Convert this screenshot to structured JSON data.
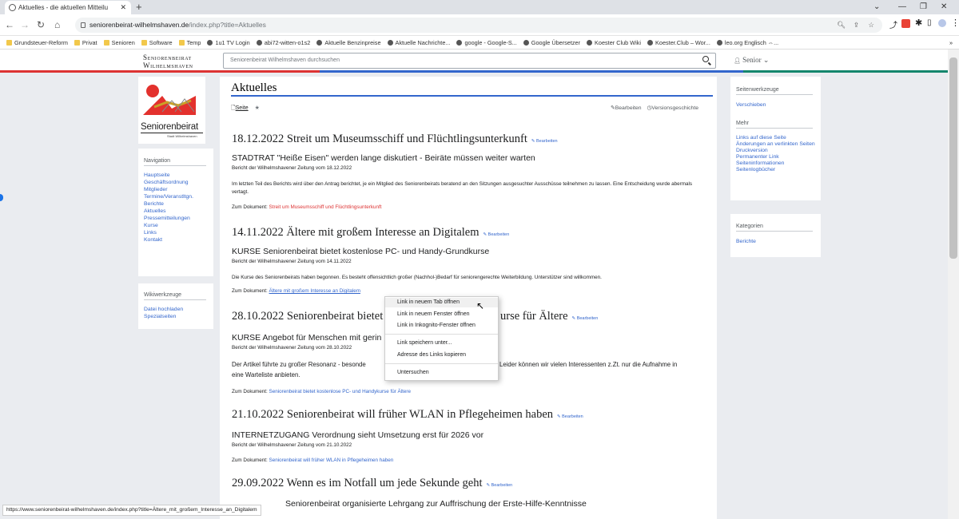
{
  "browser": {
    "tab_title": "Aktuelles - die aktuellen Mitteilu",
    "url_domain": "seniorenbeirat-wilhelmshaven.de",
    "url_path": "/index.php?title=Aktuelles",
    "bookmarks": [
      {
        "label": "Grundsteuer-Reform",
        "kind": "folder"
      },
      {
        "label": "Privat",
        "kind": "folder"
      },
      {
        "label": "Senioren",
        "kind": "folder"
      },
      {
        "label": "Software",
        "kind": "folder"
      },
      {
        "label": "Temp",
        "kind": "folder"
      },
      {
        "label": "1u1 TV Login",
        "kind": "site"
      },
      {
        "label": "abi72-witten-o1s2",
        "kind": "site"
      },
      {
        "label": "Aktuelle Benzinpreise",
        "kind": "site"
      },
      {
        "label": "Aktuelle Nachrichte...",
        "kind": "site"
      },
      {
        "label": "google - Google-S...",
        "kind": "site"
      },
      {
        "label": "Google Übersetzer",
        "kind": "site"
      },
      {
        "label": "Koester Club Wiki",
        "kind": "site"
      },
      {
        "label": "Koester.Club – Wor...",
        "kind": "site"
      },
      {
        "label": "leo.org Englisch ⇔...",
        "kind": "site"
      }
    ]
  },
  "site": {
    "logo_line1": "Seniorenbeirat",
    "logo_line2": "Wilhelmshaven",
    "search_placeholder": "Seniorenbeirat Wilhelmshaven durchsuchen",
    "user": "Senior ⌄",
    "colors": {
      "red": "#d33",
      "blue": "#36c",
      "green": "#14866d"
    }
  },
  "logo": {
    "name": "Seniorenbeirat",
    "city": "Stadt Wilhelmshaven"
  },
  "nav": {
    "heading": "Navigation",
    "items": [
      "Hauptseite",
      "Geschäftsordnung",
      "Mitglieder",
      "Termine/Veranstltgn.",
      "Berichte",
      "Aktuelles",
      "Pressemitteilungen",
      "Kurse",
      "Links",
      "Kontakt"
    ]
  },
  "wiki": {
    "heading": "Wikiwerkzeuge",
    "items": [
      "Datei hochladen",
      "Spezialseiten"
    ]
  },
  "content": {
    "title": "Aktuelles",
    "tab_page": "Seite",
    "edit": "Bearbeiten",
    "history": "Versionsgeschichte",
    "edit_small": "Bearbeiten",
    "zum": "Zum Dokument:",
    "articles": [
      {
        "heading": "18.12.2022 Streit um Museumsschiff und Flüchtlingsunterkunft",
        "sub": "STADTRAT \"Heiße Eisen\" werden lange diskutiert - Beiräte müssen weiter warten",
        "source": "Bericht der Wilhelmshavener Zeitung vom 18.12.2022",
        "text": "Im letzten Teil des Berichts wird über den Antrag berichtet, je ein Mitglied des Seniorenbeirats beratend an den Sitzungen ausgesuchter Ausschüsse teilnehmen zu lassen. Eine Entscheidung wurde abermals vertagt.",
        "link": "Streit um Museumsschiff und Flüchtlingsunterkunft"
      },
      {
        "heading": "14.11.2022 Ältere mit großem Interesse an Digitalem",
        "sub": "KURSE Seniorenbeirat bietet kostenlose PC- und Handy-Grundkurse",
        "source": "Bericht der Wilhelmshavener Zeitung vom 14.11.2022",
        "text": "Die Kurse des Seniorenbeirats haben begonnen. Es besteht offensichtlich großer (Nachhol-)Bedarf für seniorengerechte Weiterbildung. Unterstützer sind willkommen.",
        "link": "Ältere mit großem Interesse an Digitalem"
      },
      {
        "heading_left": "28.10.2022 Seniorenbeirat bietet ko",
        "heading_right": "urse für Ältere",
        "sub_left": "KURSE Angebot für Menschen mit gerin",
        "source": "Bericht der Wilhelmshavener Zeitung vom 28.10.2022",
        "text_left": "Der Artikel führte zu großer Resonanz - besonde",
        "text_right": "Leider können wir vielen Interessenten z.Zt. nur die Aufnahme in",
        "text_line2": "eine Warteliste anbieten.",
        "link": "Seniorenbeirat bietet kostenlose PC- und Handykurse für Ältere"
      },
      {
        "heading": "21.10.2022 Seniorenbeirat will früher WLAN in Pflegeheimen haben",
        "sub": "INTERNETZUGANG Verordnung sieht Umsetzung erst für 2026 vor",
        "source": "Bericht der Wilhelmshavener Zeitung vom 21.10.2022",
        "link": "Seniorenbeirat will früher WLAN in Pflegeheimen haben"
      },
      {
        "heading": "29.09.2022 Wenn es im Notfall um jede Sekunde geht",
        "sub_tail": "Seniorenbeirat organisierte Lehrgang zur Auffrischung der Erste-Hilfe-Kenntnisse"
      }
    ]
  },
  "right": {
    "heading1": "Seitenwerkzeuge",
    "item1": "Verschieben",
    "heading2": "Mehr",
    "items2": [
      "Links auf diese Seite",
      "Änderungen an verlinkten Seiten",
      "Druckversion",
      "Permanenter Link",
      "Seiteninformationen",
      "Seitenlogbücher"
    ],
    "heading3": "Kategorien",
    "item3": "Berichte"
  },
  "context_menu": [
    "Link in neuem Tab öffnen",
    "Link in neuem Fenster öffnen",
    "Link in Inkognito-Fenster öffnen",
    "Link speichern unter...",
    "Adresse des Links kopieren",
    "Untersuchen"
  ],
  "status_url": "https://www.seniorenbeirat-wilhelmshaven.de/index.php?title=Ältere_mit_großem_Interesse_an_Digitalem"
}
